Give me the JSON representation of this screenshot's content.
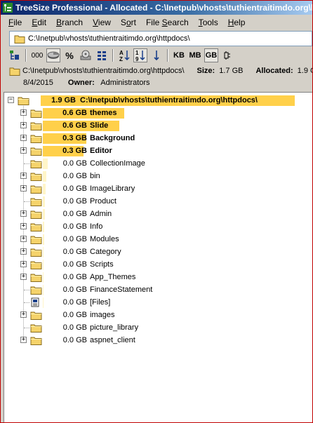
{
  "title": "TreeSize Professional - Allocated - C:\\Inetpub\\vhosts\\tuthientraitimdo.org\\httpdocs\\",
  "menu": [
    "File",
    "Edit",
    "Branch",
    "View",
    "Sort",
    "File Search",
    "Tools",
    "Help"
  ],
  "menu_accel": [
    "F",
    "E",
    "B",
    "V",
    "o",
    "S",
    "T",
    "H"
  ],
  "address": {
    "value": "C:\\Inetpub\\vhosts\\tuthientraitimdo.org\\httpdocs\\"
  },
  "toolbar": {
    "items": [
      "tree-expand-icon",
      "000",
      "pie-chart-icon",
      "%",
      "disk-icon",
      "grid-icon",
      "sort-az-icon",
      "sort-19-icon",
      "arrow-down-icon",
      "KB",
      "MB",
      "GB",
      "settings-icon"
    ],
    "unit_kb": "KB",
    "unit_mb": "MB",
    "unit_gb": "GB",
    "number_format": "000",
    "percent": "%",
    "active_unit": "GB"
  },
  "info": {
    "path": "C:\\Inetpub\\vhosts\\tuthientraitimdo.org\\httpdocs\\",
    "size_label": "Size:",
    "size_value": "1.7 GB",
    "allocated_label": "Allocated:",
    "allocated_value": "1.9 G",
    "date": "8/4/2015",
    "owner_label": "Owner:",
    "owner_value": "Administrators"
  },
  "colors": {
    "bar": "#ffd04a",
    "bar_light": "#fff5c8",
    "folder": "#f5d36b",
    "title_bg": "#0a246a"
  },
  "tree": {
    "root": {
      "size": "1.9 GB",
      "name": "C:\\Inetpub\\vhosts\\tuthientraitimdo.org\\httpdocs\\",
      "fraction": 1.0
    },
    "children": [
      {
        "size": "0.6 GB",
        "name": "themes",
        "expandable": true,
        "fraction": 0.32,
        "bold": true
      },
      {
        "size": "0.6 GB",
        "name": "Slide",
        "expandable": true,
        "fraction": 0.3,
        "bold": true
      },
      {
        "size": "0.3 GB",
        "name": "Background",
        "expandable": true,
        "fraction": 0.17,
        "bold": true
      },
      {
        "size": "0.3 GB",
        "name": "Editor",
        "expandable": true,
        "fraction": 0.16,
        "bold": true
      },
      {
        "size": "0.0 GB",
        "name": "CollectionImage",
        "expandable": false,
        "fraction": 0.02,
        "bold": false
      },
      {
        "size": "0.0 GB",
        "name": "bin",
        "expandable": true,
        "fraction": 0.015,
        "bold": false
      },
      {
        "size": "0.0 GB",
        "name": "ImageLibrary",
        "expandable": true,
        "fraction": 0.012,
        "bold": false
      },
      {
        "size": "0.0 GB",
        "name": "Product",
        "expandable": false,
        "fraction": 0.008,
        "bold": false
      },
      {
        "size": "0.0 GB",
        "name": "Admin",
        "expandable": true,
        "fraction": 0.007,
        "bold": false
      },
      {
        "size": "0.0 GB",
        "name": "Info",
        "expandable": true,
        "fraction": 0.006,
        "bold": false
      },
      {
        "size": "0.0 GB",
        "name": "Modules",
        "expandable": true,
        "fraction": 0.005,
        "bold": false
      },
      {
        "size": "0.0 GB",
        "name": "Category",
        "expandable": true,
        "fraction": 0.004,
        "bold": false
      },
      {
        "size": "0.0 GB",
        "name": "Scripts",
        "expandable": true,
        "fraction": 0.003,
        "bold": false
      },
      {
        "size": "0.0 GB",
        "name": "App_Themes",
        "expandable": true,
        "fraction": 0.003,
        "bold": false
      },
      {
        "size": "0.0 GB",
        "name": "FinanceStatement",
        "expandable": false,
        "fraction": 0.002,
        "bold": false
      },
      {
        "size": "0.0 GB",
        "name": "[Files]",
        "expandable": false,
        "fraction": 0.002,
        "bold": false,
        "files": true
      },
      {
        "size": "0.0 GB",
        "name": "images",
        "expandable": true,
        "fraction": 0.001,
        "bold": false
      },
      {
        "size": "0.0 GB",
        "name": "picture_library",
        "expandable": false,
        "fraction": 0.001,
        "bold": false
      },
      {
        "size": "0.0 GB",
        "name": "aspnet_client",
        "expandable": true,
        "fraction": 0.001,
        "bold": false
      }
    ]
  }
}
